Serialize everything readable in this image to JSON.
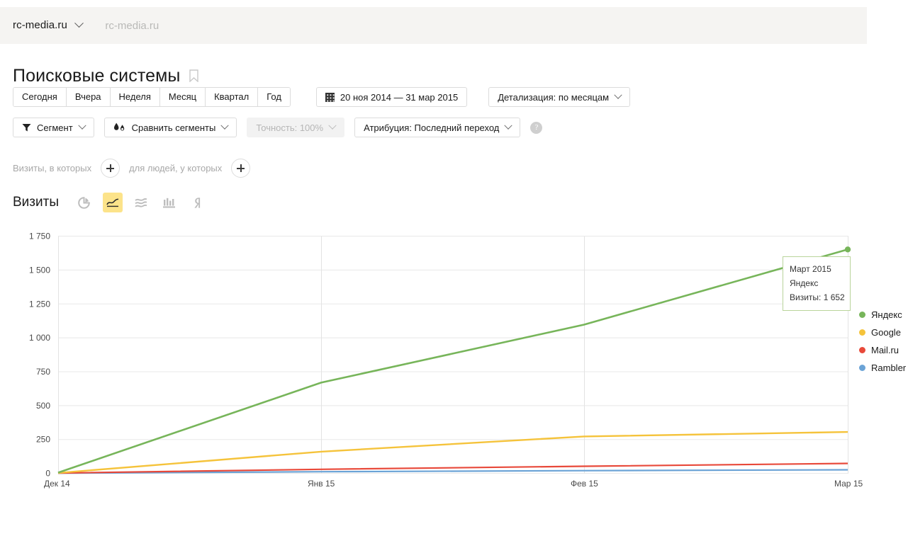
{
  "topbar": {
    "site_selector": "rc-media.ru",
    "domain_label": "rc-media.ru"
  },
  "page": {
    "title": "Поисковые системы",
    "bookmark_icon": "bookmark-icon"
  },
  "period_buttons": [
    {
      "label": "Сегодня"
    },
    {
      "label": "Вчера"
    },
    {
      "label": "Неделя"
    },
    {
      "label": "Месяц"
    },
    {
      "label": "Квартал"
    },
    {
      "label": "Год"
    }
  ],
  "date_range": {
    "icon": "calendar-icon",
    "label": "20 ноя 2014 — 31 мар 2015"
  },
  "detail_level": {
    "label": "Детализация: по месяцам"
  },
  "segment": {
    "icon": "funnel-icon",
    "label": "Сегмент"
  },
  "compare_segments": {
    "icon": "compare-drops-icon",
    "label": "Сравнить сегменты"
  },
  "accuracy": {
    "label": "Точность: 100%",
    "disabled": true
  },
  "attribution": {
    "label": "Атрибуция: Последний переход"
  },
  "help": {
    "glyph": "?"
  },
  "filters": {
    "visits_label": "Визиты, в которых",
    "people_label": "для людей, у которых",
    "add_glyph": "+"
  },
  "metric": {
    "label": "Визиты",
    "views": [
      {
        "name": "pie-chart-icon",
        "active": false
      },
      {
        "name": "line-chart-icon",
        "active": true
      },
      {
        "name": "area-chart-icon",
        "active": false
      },
      {
        "name": "bar-chart-icon",
        "active": false
      },
      {
        "name": "map-chart-icon",
        "active": false
      }
    ]
  },
  "tooltip": {
    "period": "Март 2015",
    "series": "Яндекс",
    "value_label": "Визиты: 1 652"
  },
  "chart_data": {
    "type": "line",
    "title": "Визиты",
    "xlabel": "",
    "ylabel": "",
    "x": [
      "Дек 14",
      "Янв 15",
      "Фев 15",
      "Мар 15"
    ],
    "categories": [
      "Дек 14",
      "Янв 15",
      "Фев 15",
      "Мар 15"
    ],
    "yticks": [
      0,
      250,
      500,
      750,
      1000,
      1250,
      1500,
      1750
    ],
    "ytick_labels": [
      "0",
      "250",
      "500",
      "750",
      "1 000",
      "1 250",
      "1 500",
      "1 750"
    ],
    "ylim": [
      0,
      1750
    ],
    "grid": true,
    "legend_position": "right",
    "series": [
      {
        "name": "Яндекс",
        "color": "#77b55a",
        "values": [
          5,
          669,
          1097,
          1652
        ]
      },
      {
        "name": "Google",
        "color": "#f5c33b",
        "values": [
          3,
          160,
          272,
          305
        ]
      },
      {
        "name": "Mail.ru",
        "color": "#e8493a",
        "values": [
          2,
          30,
          52,
          73
        ]
      },
      {
        "name": "Rambler",
        "color": "#6ba3d6",
        "values": [
          1,
          12,
          20,
          26
        ]
      }
    ]
  }
}
